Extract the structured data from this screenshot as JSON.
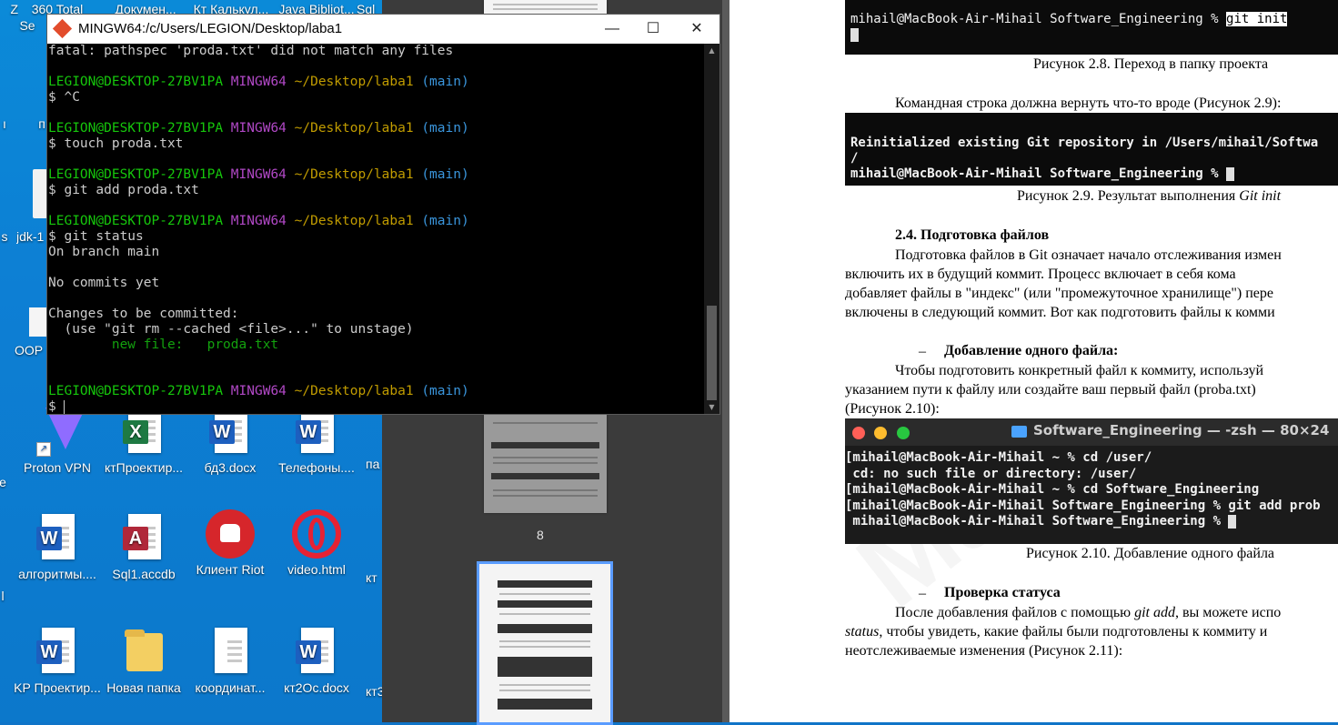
{
  "terminal": {
    "title": "MINGW64:/c/Users/LEGION/Desktop/laba1",
    "minimize": "—",
    "maximize": "☐",
    "close": "✕",
    "prompt_user": "LEGION@DESKTOP-27BV1PA",
    "prompt_env": "MINGW64",
    "prompt_path": "~/Desktop/laba1",
    "prompt_branch": "(main)",
    "line_fatal": "fatal: pathspec 'proda.txt' did not match any files",
    "cmd1": "$ ^C",
    "cmd2": "$ touch proda.txt",
    "cmd3": "$ git add proda.txt",
    "cmd4": "$ git status",
    "out1": "On branch main",
    "out2": "No commits yet",
    "out3": "Changes to be committed:",
    "out4": "  (use \"git rm --cached <file>...\" to unstage)",
    "out5": "        new file:   proda.txt",
    "cmd5": "$ "
  },
  "desktop": {
    "top_labels": [
      "Z",
      "360 Total",
      "Докумен...",
      "Кт Калькул...",
      "Java Bibliot...",
      "Sql"
    ],
    "partial_labels": [
      "Se",
      "п",
      "ı",
      "s",
      "jdk-1",
      "OOP",
      "e",
      "l",
      "па",
      "кт",
      "кт3"
    ],
    "icons": [
      {
        "label": "Proton VPN",
        "icon": "proton-vpn-icon"
      },
      {
        "label": "ктПроектир...",
        "icon": "excel-icon",
        "badge": "X"
      },
      {
        "label": "бд3.docx",
        "icon": "word-icon",
        "badge": "W"
      },
      {
        "label": "Телефоны....",
        "icon": "word-icon",
        "badge": "W"
      },
      {
        "label": "алгоритмы....",
        "icon": "word-icon",
        "badge": "W"
      },
      {
        "label": "Sql1.accdb",
        "icon": "access-icon",
        "badge": "A"
      },
      {
        "label": "Клиент Riot",
        "icon": "riot-icon"
      },
      {
        "label": "video.html",
        "icon": "opera-icon"
      },
      {
        "label": "KP Проектир...",
        "icon": "word-icon",
        "badge": "W"
      },
      {
        "label": "Новая папка",
        "icon": "folder-icon"
      },
      {
        "label": "координат...",
        "icon": "text-file-icon"
      },
      {
        "label": "кт2Ос.docx",
        "icon": "word-icon",
        "badge": "W"
      }
    ]
  },
  "pdf_viewer": {
    "page_number": "8"
  },
  "document": {
    "shot1_line": "mihail@MacBook-Air-Mihail Software_Engineering % ",
    "shot1_cmd": "git init",
    "caption1": "Рисунок 2.8. Переход в папку проекта",
    "para1": "Командная строка должна вернуть что-то вроде (Рисунок 2.9):",
    "shot2_line1": "Reinitialized existing Git repository in /Users/mihail/Softwa",
    "shot2_line2": "/",
    "shot2_line3": "mihail@MacBook-Air-Mihail Software_Engineering % ",
    "caption2_prefix": "Рисунок 2.9. Результат выполнения ",
    "caption2_italic": "Git init",
    "heading1": "2.4. Подготовка файлов",
    "para2_l1": "Подготовка файлов в Git означает начало отслеживания измен",
    "para2_l2": "включить  их  в  будущий  коммит.  Процесс  включает  в  себя  кома",
    "para2_l3": "добавляет файлы в \"индекс\" (или \"промежуточное хранилище\") пере",
    "para2_l4": "включены в следующий коммит. Вот как подготовить файлы к комми",
    "bullet": "–",
    "heading2": "Добавление одного файла:",
    "para3_l1": "Чтобы  подготовить  конкретный  файл  к  коммиту,  используй",
    "para3_l2": "указанием  пути  к  файлу  или  создайте  ваш  первый  файл  (proba.txt)",
    "para3_l3": "(Рисунок 2.10):",
    "shot3_title": "Software_Engineering — -zsh — 80×24",
    "shot3_lines": [
      "[mihail@MacBook-Air-Mihail ~ % cd /user/",
      " cd: no such file or directory: /user/",
      "[mihail@MacBook-Air-Mihail ~ % cd Software_Engineering",
      "[mihail@MacBook-Air-Mihail Software_Engineering % git add prob",
      " mihail@MacBook-Air-Mihail Software_Engineering % "
    ],
    "caption3": "Рисунок 2.10. Добавление одного файла",
    "heading3": "Проверка статуса",
    "para4_l1_a": "После добавления файлов с помощью ",
    "para4_l1_i": "git add",
    "para4_l1_b": ", вы можете испо",
    "para4_l2_i": "status",
    "para4_l2_b": ", чтобы увидеть, какие файлы были подготовлены к коммиту и",
    "para4_l3": "неотслеживаемые изменения (Рисунок 2.11):",
    "watermark": "Ma"
  },
  "colors": {
    "prompt_user": "#16c60c",
    "prompt_env": "#b148c6",
    "prompt_path": "#c19c00",
    "prompt_branch": "#3a96dd"
  }
}
